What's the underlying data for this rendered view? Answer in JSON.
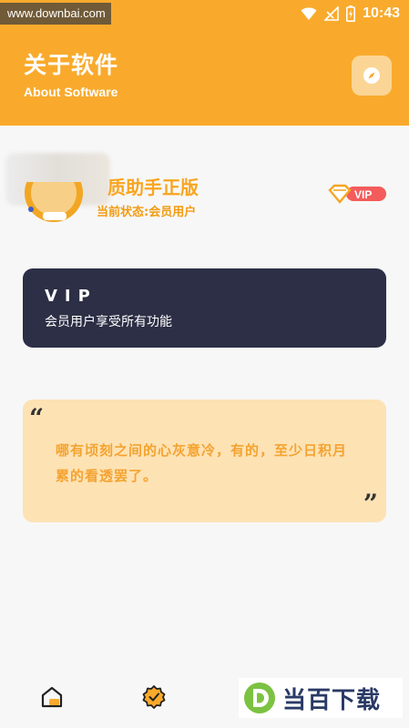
{
  "status_bar": {
    "watermark": "www.downbai.com",
    "time": "10:43"
  },
  "header": {
    "title_cn": "关于软件",
    "title_en": "About Software",
    "accent_color": "#f9aa2c"
  },
  "profile": {
    "app_name": "质助手正版",
    "status_text": "当前状态:会员用户",
    "badge_label": "VIP"
  },
  "vip_card": {
    "title": "VIP",
    "description": "会员用户享受所有功能"
  },
  "quote_card": {
    "text": "哪有顷刻之间的心灰意冷，有的，至少日积月累的看透罢了。"
  },
  "bottom_nav": {
    "items": [
      {
        "icon": "home-icon"
      },
      {
        "icon": "badge-check-icon"
      }
    ]
  },
  "logo_watermark": {
    "text": "当百下载"
  }
}
